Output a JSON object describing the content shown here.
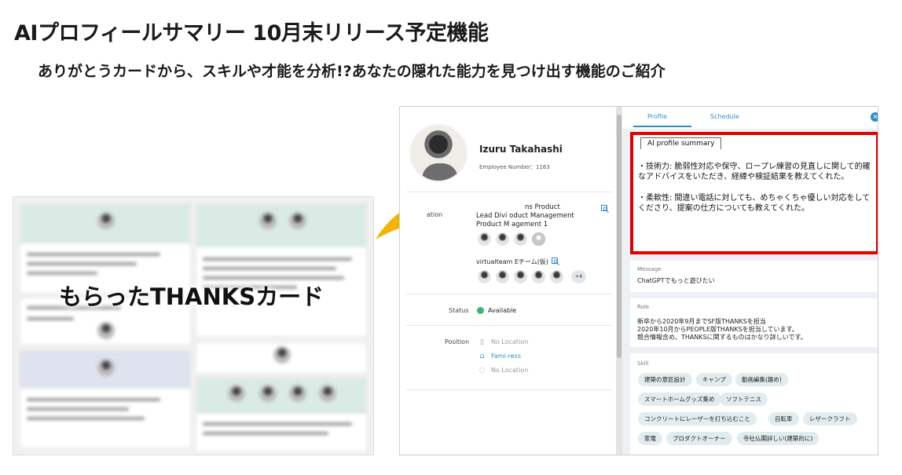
{
  "slide": {
    "title": "AIプロフィールサマリー 10月末リリース予定機能",
    "subtitle": "ありがとうカードから、スキルや才能を分析!?あなたの隠れた能力を見つけ出す機能のご紹介",
    "cards_label": "もらったTHANKSカード"
  },
  "colors": {
    "accent": "#2e8fc7",
    "highlight_border": "#e40000",
    "arrow": "#f5b400",
    "status": "#3cb371"
  },
  "profile": {
    "name": "Izuru Takahashi",
    "employee_number": "Employee Number：1163",
    "affiliation_label": "ation",
    "affiliation_lines": [
      "ns Product",
      "Lead Divi    oduct Management",
      "Product M    agement 1"
    ],
    "team_name": "virtualteam Eチーム(仮)",
    "team_more": "+4",
    "status_label": "Status",
    "status_value": "Available",
    "position_label": "Position",
    "positions": [
      {
        "icon": "device-icon",
        "text": "No Location",
        "color": "#9a9a9a"
      },
      {
        "icon": "building-icon",
        "text": "Fami-ress",
        "color": "#2e8fc7"
      },
      {
        "icon": "wifi-icon",
        "text": "No Location",
        "color": "#9a9a9a"
      }
    ]
  },
  "tabs": {
    "profile": "Profile",
    "schedule": "Schedule",
    "close_icon": "close-icon"
  },
  "ai_summary": {
    "tab_label": "AI profile summary",
    "paragraphs": [
      "・技術力: 脆弱性対応や保守、ロープレ練習の見直しに関して的確なアドバイスをいただき、経緯や検証結果を教えてくれた。",
      "・柔軟性: 間違い電話に対しても、めちゃくちゃ優しい対応をしてくださり、提案の仕方についても教えてくれた。"
    ]
  },
  "message": {
    "label": "Message",
    "text": "ChatGPTでもっと遊びたい"
  },
  "role": {
    "label": "Role",
    "lines": [
      "新卒から2020年9月までSF版THANKSを担当",
      "2020年10月からPEOPLE版THANKSを担当しています。",
      "競合情報含め、THANKSに関するものはかなり詳しいです。"
    ]
  },
  "skill": {
    "label": "Skill",
    "rows": [
      [
        "建築の意匠設計",
        "キャンプ",
        "動画編集(趣め)"
      ],
      [
        "スマートホームグッズ集め",
        "ソフトテニス"
      ],
      [
        "コンクリートにレーザーを打ち込むこと",
        "自転車",
        "レザークラフト"
      ],
      [
        "家電",
        "プロダクトオーナー",
        "寺社仏閣詳しい(建築的に)"
      ]
    ]
  }
}
